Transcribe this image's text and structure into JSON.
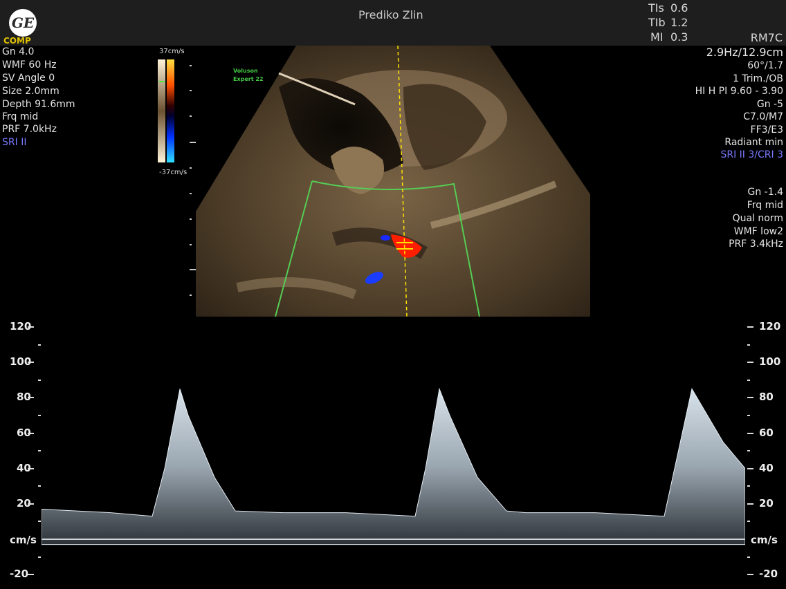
{
  "header": {
    "hospital": "Prediko Zlin",
    "logo_text": "GE",
    "comp_label": "COMP",
    "safety": [
      {
        "label": "TIs",
        "value": "0.6"
      },
      {
        "label": "TIb",
        "value": "1.2"
      },
      {
        "label": "MI",
        "value": "0.3"
      }
    ],
    "probe": "RM7C"
  },
  "left_params": {
    "gain": "Gn  4.0",
    "wmf": "WMF 60 Hz",
    "sv_angle": "SV Angle  0",
    "size": "Size  2.0mm",
    "depth": "Depth 91.6mm",
    "frq": "Frq mid",
    "prf": "PRF  7.0kHz",
    "sri": "SRI II"
  },
  "right_params": {
    "frame": "2.9Hz/12.9cm",
    "angle": "60°/1.7",
    "preset": "1 Trim./OB",
    "hi": "HI H PI 9.60 - 3.90",
    "gain": "Gn  -5",
    "c": "C7.0/M7",
    "ff": "FF3/E3",
    "radiant": "Radiant min",
    "sri": "SRI II 3/CRI 3",
    "color_gain": "Gn -1.4",
    "color_frq": "Frq mid",
    "qual": "Qual norm",
    "color_wmf": "WMF low2",
    "color_prf": "PRF  3.4kHz"
  },
  "colorbar": {
    "top": "37cm/s",
    "bottom": "-37cm/s"
  },
  "brand": {
    "line1": "Voluson",
    "line2": "Expert 22"
  },
  "spectrum": {
    "unit": "cm/s",
    "scale_labels": [
      "120",
      "100",
      "80",
      "60",
      "40",
      "20",
      "-20"
    ]
  },
  "chart_data": {
    "type": "area",
    "ylabel": "cm/s",
    "ylim": [
      -25,
      125
    ],
    "x": [
      0,
      100,
      160,
      178,
      200,
      212,
      250,
      280,
      350,
      440,
      540,
      555,
      575,
      590,
      630,
      672,
      700,
      800,
      900,
      915,
      940,
      955,
      985,
      1017
    ],
    "y": [
      17,
      15,
      13,
      40,
      85,
      70,
      35,
      16,
      15,
      15,
      13,
      40,
      85,
      70,
      35,
      16,
      15,
      15,
      13,
      40,
      85,
      75,
      55,
      40
    ],
    "series": [
      {
        "values": [
          17,
          15,
          13,
          40,
          85,
          70,
          35,
          16,
          15,
          15,
          13,
          40,
          85,
          70,
          35,
          16,
          15,
          15,
          13,
          40,
          85,
          75,
          55,
          40
        ]
      }
    ]
  }
}
